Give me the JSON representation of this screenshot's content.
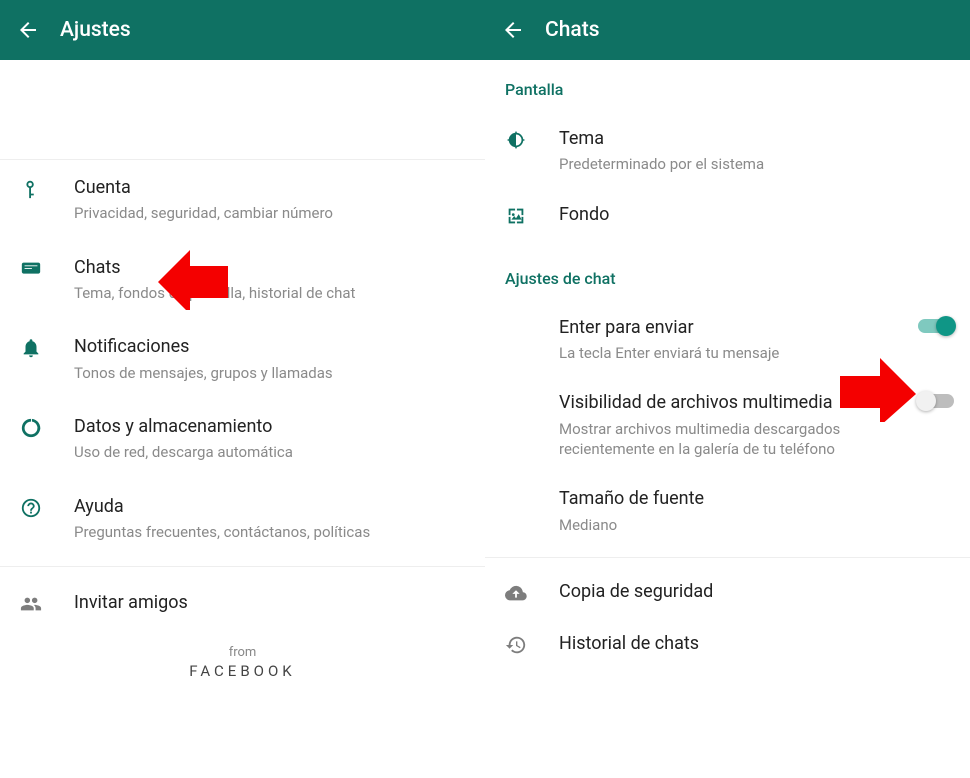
{
  "left": {
    "header_title": "Ajustes",
    "items": {
      "account": {
        "title": "Cuenta",
        "sub": "Privacidad, seguridad, cambiar número"
      },
      "chats": {
        "title": "Chats",
        "sub": "Tema, fondos de pantalla, historial de chat"
      },
      "notifications": {
        "title": "Notificaciones",
        "sub": "Tonos de mensajes, grupos y llamadas"
      },
      "data": {
        "title": "Datos y almacenamiento",
        "sub": "Uso de red, descarga automática"
      },
      "help": {
        "title": "Ayuda",
        "sub": "Preguntas frecuentes, contáctanos, políticas"
      },
      "invite": {
        "title": "Invitar amigos"
      }
    },
    "footer": {
      "from": "from",
      "brand": "FACEBOOK"
    }
  },
  "right": {
    "header_title": "Chats",
    "sections": {
      "display": "Pantalla",
      "chat_settings": "Ajustes de chat"
    },
    "items": {
      "theme": {
        "title": "Tema",
        "sub": "Predeterminado por el sistema"
      },
      "wallpaper": {
        "title": "Fondo"
      },
      "enter_send": {
        "title": "Enter para enviar",
        "sub": "La tecla Enter enviará tu mensaje",
        "value": true
      },
      "media_vis": {
        "title": "Visibilidad de archivos multimedia",
        "sub": "Mostrar archivos multimedia descargados recientemente en la galería de tu teléfono",
        "value": false
      },
      "font_size": {
        "title": "Tamaño de fuente",
        "sub": "Mediano"
      },
      "backup": {
        "title": "Copia de seguridad"
      },
      "history": {
        "title": "Historial de chats"
      }
    }
  }
}
